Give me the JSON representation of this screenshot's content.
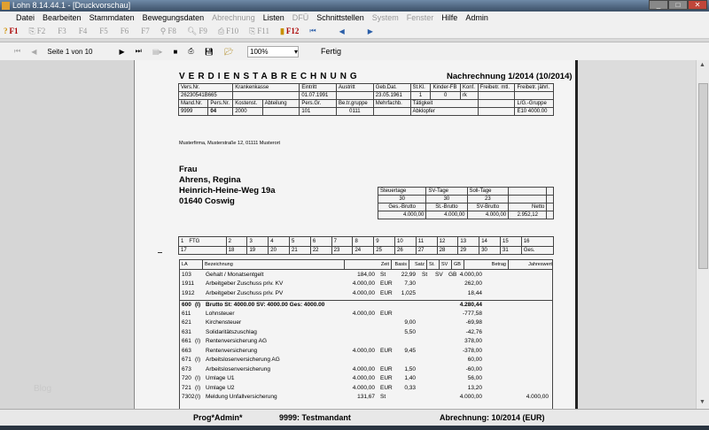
{
  "window": {
    "title": "Lohn 8.14.44.1 - [Druckvorschau]",
    "min": "_",
    "max": "□",
    "close": "✕"
  },
  "menu": [
    {
      "label": "Datei",
      "enabled": true
    },
    {
      "label": "Bearbeiten",
      "enabled": true
    },
    {
      "label": "Stammdaten",
      "enabled": true
    },
    {
      "label": "Bewegungsdaten",
      "enabled": true
    },
    {
      "label": "Abrechnung",
      "enabled": false
    },
    {
      "label": "Listen",
      "enabled": true
    },
    {
      "label": "DFÜ",
      "enabled": false
    },
    {
      "label": "Schnittstellen",
      "enabled": true
    },
    {
      "label": "System",
      "enabled": false
    },
    {
      "label": "Fenster",
      "enabled": false
    },
    {
      "label": "Hilfe",
      "enabled": true
    },
    {
      "label": "Admin",
      "enabled": true
    }
  ],
  "fkeys": [
    {
      "icon": "?",
      "label": "F1"
    },
    {
      "icon": "⎘",
      "label": "F2"
    },
    {
      "icon": "",
      "label": "F3"
    },
    {
      "icon": "",
      "label": "F4"
    },
    {
      "icon": "",
      "label": "F5"
    },
    {
      "icon": "",
      "label": "F6"
    },
    {
      "icon": "",
      "label": "F7"
    },
    {
      "icon": "⚲",
      "label": "F8"
    },
    {
      "icon": "🔍︎",
      "label": "F9"
    },
    {
      "icon": "⎙",
      "label": "F10"
    },
    {
      "icon": "⎘",
      "label": "F11"
    },
    {
      "icon": "▮",
      "label": "F12"
    }
  ],
  "preview": {
    "page_label": "Seite 1 von 10",
    "zoom": "100%",
    "status": "Fertig"
  },
  "doc": {
    "title": "VERDIENSTABRECHNUNG",
    "subtitle": "Nachrechnung 1/2014 (10/2014)",
    "head1": [
      "Vers.Nr.",
      "Krankenkasse",
      "Eintritt",
      "Austritt",
      "Geb.Dat.",
      "St.Kl.",
      "Kinder-FB",
      "Konf.",
      "Freibetr. mtl.",
      "Freibetr. jährl."
    ],
    "val1": [
      "26230541B665",
      "",
      "01.07.1991",
      "",
      "23.05.1961",
      "1",
      "0",
      "rk",
      "",
      ""
    ],
    "head2": [
      "Mand.Nr.",
      "Pers.Nr.",
      "Kostenst.",
      "Abteilung",
      "Pers.Gr.",
      "Be.tr.gruppe",
      "Mehrfachb.",
      "Tätigkeit",
      "",
      "L/G.-Gruppe"
    ],
    "val2": [
      "9999",
      "04",
      "2000",
      "",
      "101",
      "0111",
      "",
      "Abklopfer",
      "",
      "E10 4000.00"
    ],
    "firm": "Musterfirma, Musterstraße 12, 01111 Musterort",
    "address": [
      "Frau",
      "Ahrens, Regina",
      "Heinrich-Heine-Weg 19a",
      "01640 Coswig"
    ],
    "sum_head1": [
      "Steuertage",
      "SV-Tage",
      "Soll-Tage",
      "",
      ""
    ],
    "sum_val1": [
      "30",
      "30",
      "23",
      "",
      ""
    ],
    "sum_head2": [
      "Ges.-Brutto",
      "St.-Brutto",
      "SV-Brutto",
      "Netto",
      ""
    ],
    "sum_val2": [
      "4.000,00",
      "4.000,00",
      "4.000,00",
      "2.952,12",
      ""
    ],
    "days_row1": [
      "1",
      "2",
      "3",
      "4",
      "5",
      "6",
      "7",
      "8",
      "9",
      "10",
      "11",
      "12",
      "13",
      "14",
      "15",
      "16"
    ],
    "days_row2": [
      "17",
      "18",
      "19",
      "20",
      "21",
      "22",
      "23",
      "24",
      "25",
      "26",
      "27",
      "28",
      "29",
      "30",
      "31",
      "Ges."
    ],
    "ftg": "FTG",
    "cols": [
      "LA",
      "Bezeichnung",
      "Zeit",
      "Basis",
      "Satz",
      "St.",
      "SV",
      "GB",
      "Betrag",
      "Jahreswert"
    ],
    "lines": [
      {
        "la": "103",
        "f": "",
        "text": "Gehalt / Monatsentgelt",
        "zeit": "184,00",
        "basis": "St",
        "satz": "22,99",
        "st": "St",
        "sv": "SV",
        "gb": "GB",
        "betrag": "4.000,00",
        "jahr": ""
      },
      {
        "la": "1911",
        "f": "",
        "text": "Arbeitgeber Zuschuss priv. KV",
        "zeit": "4.000,00",
        "basis": "EUR",
        "satz": "7,30",
        "st": "",
        "sv": "",
        "gb": "",
        "betrag": "262,00",
        "jahr": ""
      },
      {
        "la": "1912",
        "f": "",
        "text": "Arbeitgeber Zuschuss priv. PV",
        "zeit": "4.000,00",
        "basis": "EUR",
        "satz": "1,025",
        "st": "",
        "sv": "",
        "gb": "",
        "betrag": "18,44",
        "jahr": ""
      },
      {
        "la": "600",
        "f": "(I)",
        "text": "Brutto  St:  4000.00 SV:  4000.00 Ges:  4000.00",
        "zeit": "",
        "basis": "",
        "satz": "",
        "st": "",
        "sv": "",
        "gb": "",
        "betrag": "4.280,44",
        "jahr": "",
        "bold": true
      },
      {
        "la": "611",
        "f": "",
        "text": "Lohnsteuer",
        "zeit": "4.000,00",
        "basis": "EUR",
        "satz": "",
        "st": "",
        "sv": "",
        "gb": "",
        "betrag": "-777,58",
        "jahr": ""
      },
      {
        "la": "621",
        "f": "",
        "text": "Kirchensteuer",
        "zeit": "",
        "basis": "",
        "satz": "9,00",
        "st": "",
        "sv": "",
        "gb": "",
        "betrag": "-69,98",
        "jahr": ""
      },
      {
        "la": "631",
        "f": "",
        "text": "Solidaritätszuschlag",
        "zeit": "",
        "basis": "",
        "satz": "5,50",
        "st": "",
        "sv": "",
        "gb": "",
        "betrag": "-42,76",
        "jahr": ""
      },
      {
        "la": "661",
        "f": "(I)",
        "text": "Rentenversicherung AG",
        "zeit": "",
        "basis": "",
        "satz": "",
        "st": "",
        "sv": "",
        "gb": "",
        "betrag": "378,00",
        "jahr": ""
      },
      {
        "la": "663",
        "f": "",
        "text": "Rentenversicherung",
        "zeit": "4.000,00",
        "basis": "EUR",
        "satz": "9,45",
        "st": "",
        "sv": "",
        "gb": "",
        "betrag": "-378,00",
        "jahr": ""
      },
      {
        "la": "671",
        "f": "(I)",
        "text": "Arbeitslosenversicherung AG",
        "zeit": "",
        "basis": "",
        "satz": "",
        "st": "",
        "sv": "",
        "gb": "",
        "betrag": "60,00",
        "jahr": ""
      },
      {
        "la": "673",
        "f": "",
        "text": "Arbeitslosenversicherung",
        "zeit": "4.000,00",
        "basis": "EUR",
        "satz": "1,50",
        "st": "",
        "sv": "",
        "gb": "",
        "betrag": "-60,00",
        "jahr": ""
      },
      {
        "la": "720",
        "f": "(I)",
        "text": "Umlage U1",
        "zeit": "4.000,00",
        "basis": "EUR",
        "satz": "1,40",
        "st": "",
        "sv": "",
        "gb": "",
        "betrag": "56,00",
        "jahr": ""
      },
      {
        "la": "721",
        "f": "(I)",
        "text": "Umlage U2",
        "zeit": "4.000,00",
        "basis": "EUR",
        "satz": "0,33",
        "st": "",
        "sv": "",
        "gb": "",
        "betrag": "13,20",
        "jahr": ""
      },
      {
        "la": "7302",
        "f": "(I)",
        "text": "Meldung Unfallversicherung",
        "zeit": "131,67",
        "basis": "St",
        "satz": "",
        "st": "",
        "sv": "",
        "gb": "",
        "betrag": "4.000,00",
        "jahr": "4.000,00"
      }
    ]
  },
  "left_watermark": "Blog",
  "statusbar": {
    "user": "Prog*Admin*",
    "mandant": "9999: Testmandant",
    "period": "Abrechnung: 10/2014 (EUR)"
  }
}
